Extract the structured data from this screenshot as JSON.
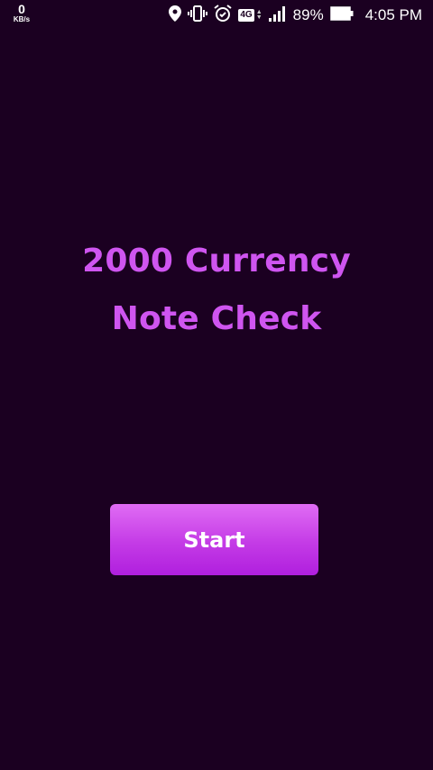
{
  "status_bar": {
    "net_speed_value": "0",
    "net_speed_unit": "KB/s",
    "network_type": "4G",
    "battery_percent": "89%",
    "time": "4:05 PM",
    "icons": [
      "location-icon",
      "vibrate-icon",
      "alarm-icon",
      "4g-icon",
      "signal-icon",
      "battery-icon"
    ]
  },
  "main": {
    "title_line1": "2000 Currency",
    "title_line2": "Note Check",
    "start_label": "Start"
  },
  "colors": {
    "background": "#1b0021",
    "title": "#cf55f0",
    "button_top": "#e06cf4",
    "button_bottom": "#b01fde"
  }
}
